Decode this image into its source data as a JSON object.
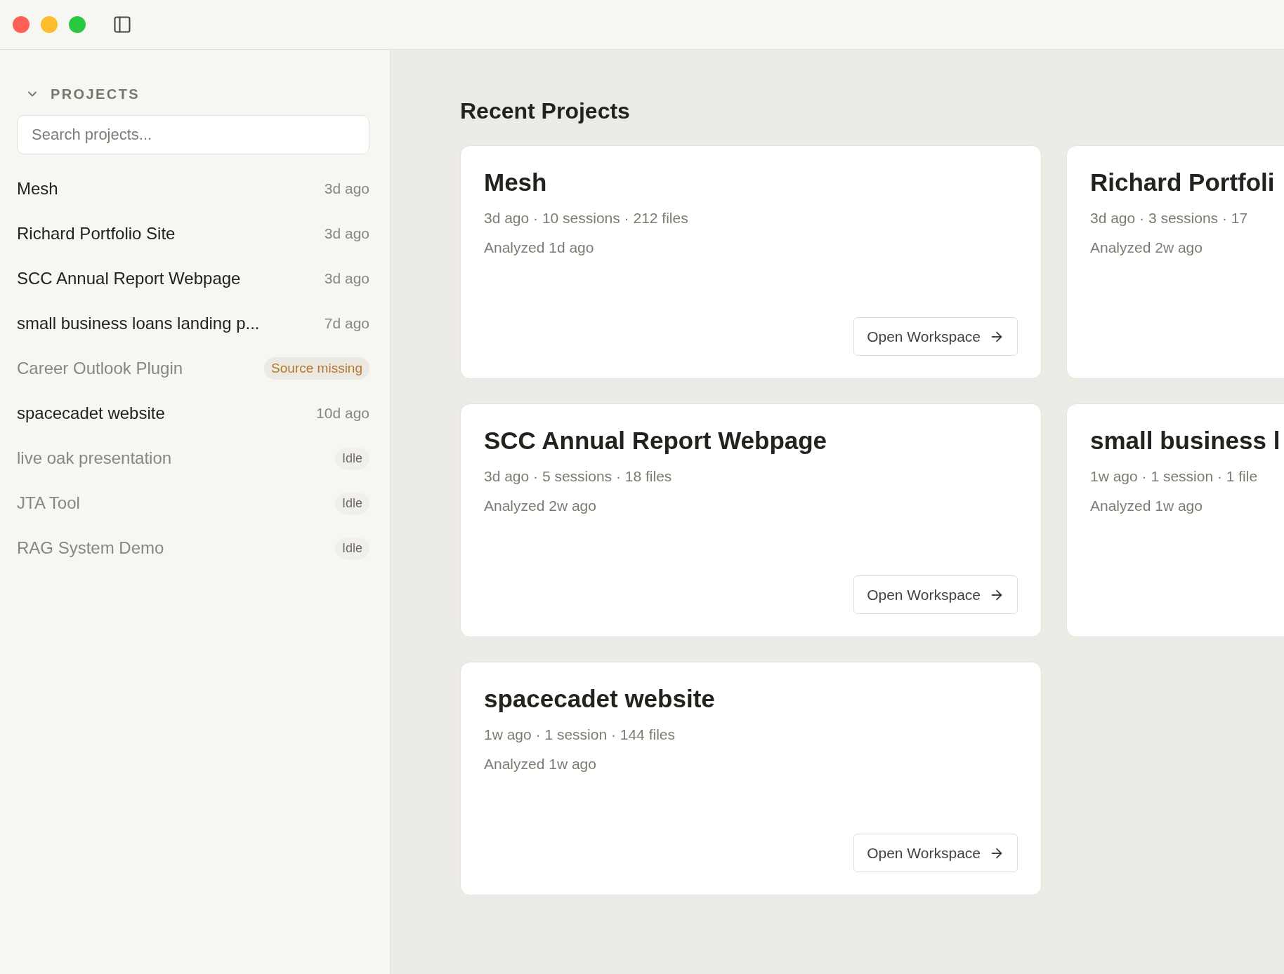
{
  "sidebar": {
    "section": {
      "title": "PROJECTS",
      "expanded": true
    },
    "search": {
      "placeholder": "Search projects..."
    },
    "projects": [
      {
        "name": "Mesh",
        "kind": "recent",
        "status": "3d ago"
      },
      {
        "name": "Richard Portfolio Site",
        "kind": "recent",
        "status": "3d ago"
      },
      {
        "name": "SCC Annual Report Webpage",
        "kind": "recent",
        "status": "3d ago"
      },
      {
        "name": "small business loans landing p...",
        "kind": "recent",
        "status": "7d ago"
      },
      {
        "name": "Career Outlook Plugin",
        "kind": "missing",
        "status": "Source missing"
      },
      {
        "name": "spacecadet website",
        "kind": "recent",
        "status": "10d ago"
      },
      {
        "name": "live oak presentation",
        "kind": "idle",
        "status": "Idle"
      },
      {
        "name": "JTA Tool",
        "kind": "idle",
        "status": "Idle"
      },
      {
        "name": "RAG System Demo",
        "kind": "idle",
        "status": "Idle"
      }
    ]
  },
  "main": {
    "title": "Recent Projects",
    "cards": [
      {
        "title": "Mesh",
        "meta": "3d ago · 10 sessions · 212 files",
        "analyzed": "Analyzed 1d ago",
        "button": "Open Workspace"
      },
      {
        "title": "Richard Portfoli",
        "meta": "3d ago · 3 sessions · 17",
        "analyzed": "Analyzed 2w ago"
      },
      {
        "title": "SCC Annual Report Webpage",
        "meta": "3d ago · 5 sessions · 18 files",
        "analyzed": "Analyzed 2w ago",
        "button": "Open Workspace"
      },
      {
        "title": "small business l",
        "meta": "1w ago · 1 session · 1 file",
        "analyzed": "Analyzed 1w ago"
      },
      {
        "title": "spacecadet website",
        "meta": "1w ago · 1 session · 144 files",
        "analyzed": "Analyzed 1w ago",
        "button": "Open Workspace"
      }
    ]
  }
}
